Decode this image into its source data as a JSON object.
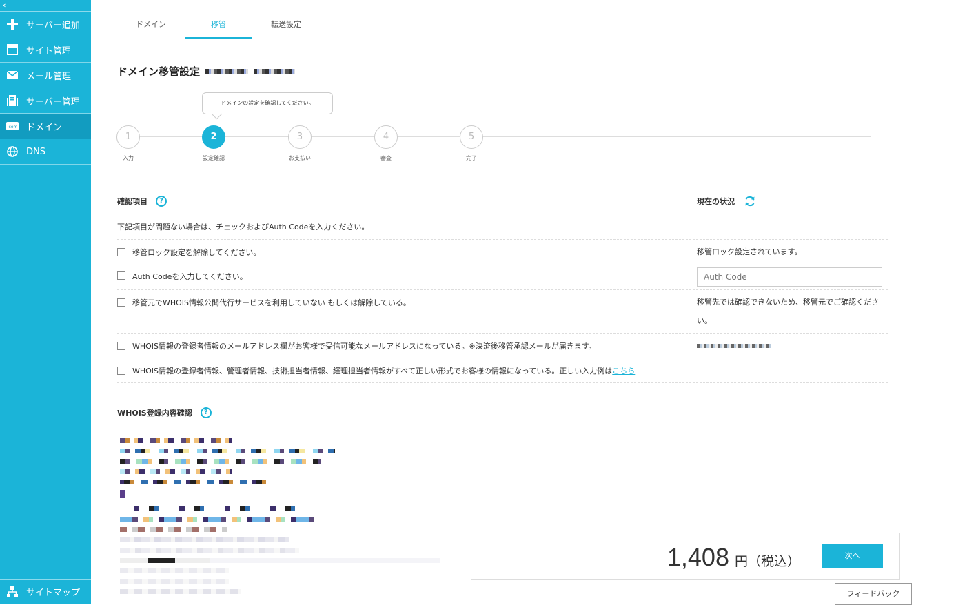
{
  "sidebar": {
    "collapse_label": "‹",
    "items": [
      {
        "label": "サーバー追加",
        "icon": "plus-icon"
      },
      {
        "label": "サイト管理",
        "icon": "window-icon"
      },
      {
        "label": "メール管理",
        "icon": "mail-icon"
      },
      {
        "label": "サーバー管理",
        "icon": "server-icon"
      },
      {
        "label": "ドメイン",
        "icon": "domain-icon"
      },
      {
        "label": "DNS",
        "icon": "globe-icon"
      }
    ],
    "sitemap_label": "サイトマップ"
  },
  "tabs": [
    {
      "label": "ドメイン"
    },
    {
      "label": "移管",
      "active": true
    },
    {
      "label": "転送設定"
    }
  ],
  "page_title": "ドメイン移管設定",
  "tooltip": "ドメインの設定を確認してください。",
  "steps": [
    {
      "number": "1",
      "label": "入力"
    },
    {
      "number": "2",
      "label": "設定確認",
      "active": true
    },
    {
      "number": "3",
      "label": "お支払い"
    },
    {
      "number": "4",
      "label": "審査"
    },
    {
      "number": "5",
      "label": "完了"
    }
  ],
  "check_section": {
    "title": "確認項目",
    "status_title": "現在の状況",
    "description": "下記項目が問題ない場合は、チェックおよびAuth Codeを入力ください。",
    "items": [
      {
        "text": "移管ロック設定を解除してください。",
        "status": "移管ロック設定されています。"
      },
      {
        "text": "Auth Codeを入力してください。",
        "input_placeholder": "Auth Code"
      },
      {
        "text": "移管元でWHOIS情報公開代行サービスを利用していない もしくは解除している。",
        "status": "移管先では確認できないため、移管元でご確認ください。"
      },
      {
        "text": "WHOIS情報の登録者情報のメールアドレス欄がお客様で受信可能なメールアドレスになっている。※決済後移管承認メールが届きます。"
      },
      {
        "text": "WHOIS情報の登録者情報、管理者情報、技術担当者情報、経理担当者情報がすべて正しい形式でお客様の情報になっている。正しい入力例は",
        "link": "こちら"
      }
    ]
  },
  "whois_section": {
    "title": "WHOIS登録内容確認"
  },
  "price": {
    "amount": "1,408",
    "unit": "円（税込）"
  },
  "next_button": "次へ",
  "feedback_button": "フィードバック",
  "colors": {
    "accent": "#1bb4d8",
    "accent_dark": "#129cc0"
  }
}
